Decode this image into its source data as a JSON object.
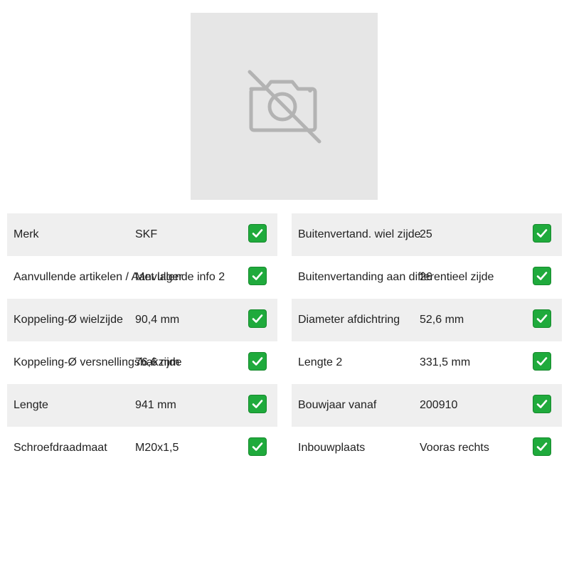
{
  "product_image": {
    "icon": "no-photo-icon",
    "background": "#e6e6e6",
    "icon_color": "#b3b3b3"
  },
  "check_color": "#1faa3c",
  "left_table": [
    {
      "label": "Merk",
      "value": "SKF"
    },
    {
      "label": "Aanvullende artikelen / Aanvullende info 2",
      "value": "Met lager"
    },
    {
      "label": "Koppeling-Ø wielzijde",
      "value": "90,4 mm"
    },
    {
      "label": "Koppeling-Ø versnellingsbakzijde",
      "value": "76,6 mm"
    },
    {
      "label": "Lengte",
      "value": "941 mm"
    },
    {
      "label": "Schroefdraadmaat",
      "value": "M20x1,5"
    }
  ],
  "right_table": [
    {
      "label": "Buitenvertand. wiel zijde",
      "value": "25"
    },
    {
      "label": "Buitenvertanding aan differentieel zijde",
      "value": "26"
    },
    {
      "label": "Diameter afdichtring",
      "value": "52,6 mm"
    },
    {
      "label": "Lengte 2",
      "value": "331,5 mm"
    },
    {
      "label": "Bouwjaar vanaf",
      "value": "200910"
    },
    {
      "label": "Inbouwplaats",
      "value": "Vooras rechts"
    }
  ]
}
